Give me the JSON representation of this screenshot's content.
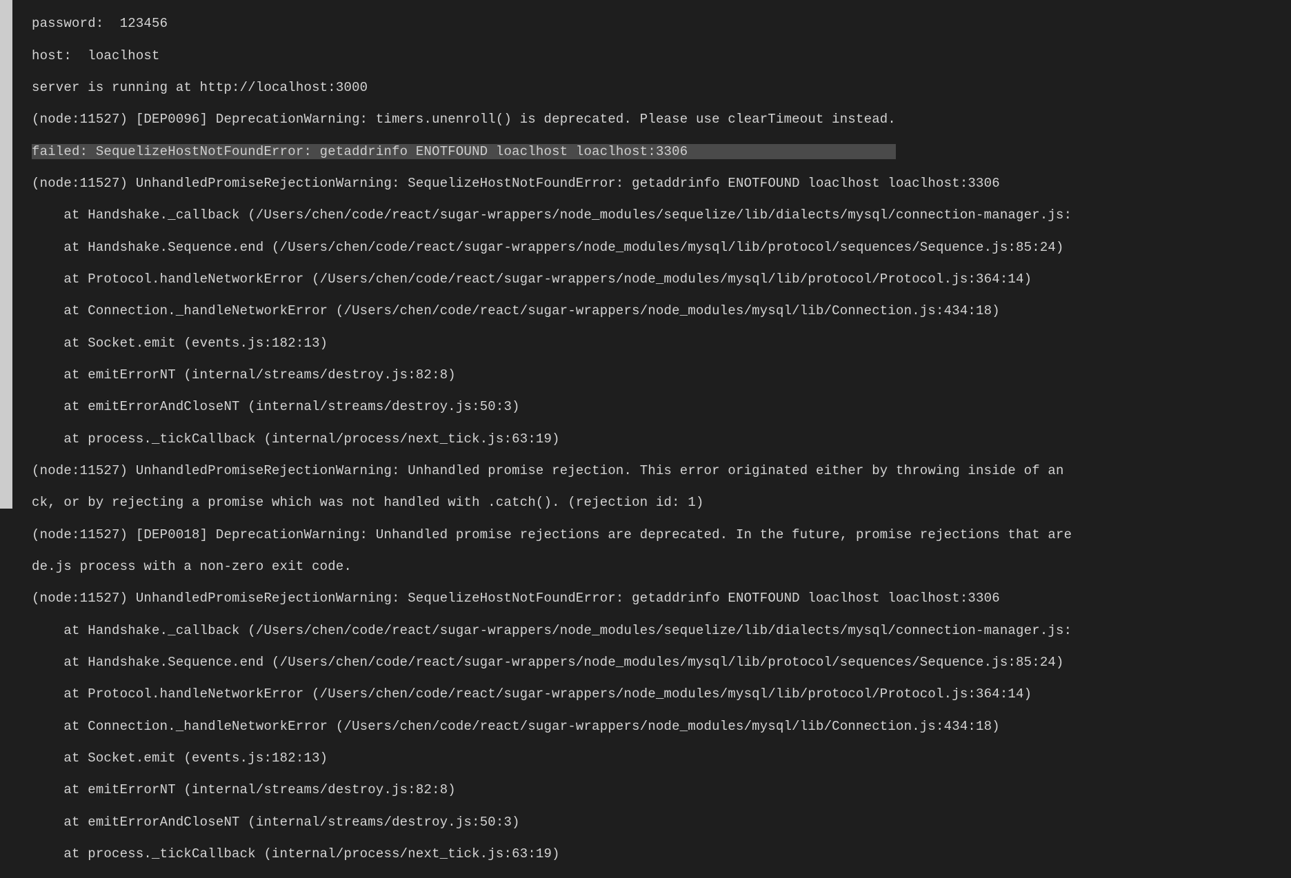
{
  "lines": [
    {
      "text": "password:  123456",
      "cls": "line",
      "selected": false
    },
    {
      "text": "host:  loaclhost",
      "cls": "line",
      "selected": false
    },
    {
      "text": "server is running at http://localhost:3000",
      "cls": "line",
      "selected": false
    },
    {
      "text": "(node:11527) [DEP0096] DeprecationWarning: timers.unenroll() is deprecated. Please use clearTimeout instead.",
      "cls": "line",
      "selected": false
    },
    {
      "text": "failed: SequelizeHostNotFoundError: getaddrinfo ENOTFOUND loaclhost loaclhost:3306                          ",
      "cls": "line",
      "selected": true
    },
    {
      "text": "(node:11527) UnhandledPromiseRejectionWarning: SequelizeHostNotFoundError: getaddrinfo ENOTFOUND loaclhost loaclhost:3306",
      "cls": "line",
      "selected": false
    },
    {
      "text": "    at Handshake._callback (/Users/chen/code/react/sugar-wrappers/node_modules/sequelize/lib/dialects/mysql/connection-manager.js:",
      "cls": "line",
      "selected": false
    },
    {
      "text": "    at Handshake.Sequence.end (/Users/chen/code/react/sugar-wrappers/node_modules/mysql/lib/protocol/sequences/Sequence.js:85:24)",
      "cls": "line",
      "selected": false
    },
    {
      "text": "    at Protocol.handleNetworkError (/Users/chen/code/react/sugar-wrappers/node_modules/mysql/lib/protocol/Protocol.js:364:14)",
      "cls": "line",
      "selected": false
    },
    {
      "text": "    at Connection._handleNetworkError (/Users/chen/code/react/sugar-wrappers/node_modules/mysql/lib/Connection.js:434:18)",
      "cls": "line",
      "selected": false
    },
    {
      "text": "    at Socket.emit (events.js:182:13)",
      "cls": "line",
      "selected": false
    },
    {
      "text": "    at emitErrorNT (internal/streams/destroy.js:82:8)",
      "cls": "line",
      "selected": false
    },
    {
      "text": "    at emitErrorAndCloseNT (internal/streams/destroy.js:50:3)",
      "cls": "line",
      "selected": false
    },
    {
      "text": "    at process._tickCallback (internal/process/next_tick.js:63:19)",
      "cls": "line",
      "selected": false
    },
    {
      "text": "(node:11527) UnhandledPromiseRejectionWarning: Unhandled promise rejection. This error originated either by throwing inside of an",
      "cls": "line",
      "selected": false
    },
    {
      "text": "ck, or by rejecting a promise which was not handled with .catch(). (rejection id: 1)",
      "cls": "line",
      "selected": false
    },
    {
      "text": "(node:11527) [DEP0018] DeprecationWarning: Unhandled promise rejections are deprecated. In the future, promise rejections that are",
      "cls": "line",
      "selected": false
    },
    {
      "text": "de.js process with a non-zero exit code.",
      "cls": "line",
      "selected": false
    },
    {
      "text": "(node:11527) UnhandledPromiseRejectionWarning: SequelizeHostNotFoundError: getaddrinfo ENOTFOUND loaclhost loaclhost:3306",
      "cls": "line",
      "selected": false
    },
    {
      "text": "    at Handshake._callback (/Users/chen/code/react/sugar-wrappers/node_modules/sequelize/lib/dialects/mysql/connection-manager.js:",
      "cls": "line",
      "selected": false
    },
    {
      "text": "    at Handshake.Sequence.end (/Users/chen/code/react/sugar-wrappers/node_modules/mysql/lib/protocol/sequences/Sequence.js:85:24)",
      "cls": "line",
      "selected": false
    },
    {
      "text": "    at Protocol.handleNetworkError (/Users/chen/code/react/sugar-wrappers/node_modules/mysql/lib/protocol/Protocol.js:364:14)",
      "cls": "line",
      "selected": false
    },
    {
      "text": "    at Connection._handleNetworkError (/Users/chen/code/react/sugar-wrappers/node_modules/mysql/lib/Connection.js:434:18)",
      "cls": "line",
      "selected": false
    },
    {
      "text": "    at Socket.emit (events.js:182:13)",
      "cls": "line",
      "selected": false
    },
    {
      "text": "    at emitErrorNT (internal/streams/destroy.js:82:8)",
      "cls": "line",
      "selected": false
    },
    {
      "text": "    at emitErrorAndCloseNT (internal/streams/destroy.js:50:3)",
      "cls": "line",
      "selected": false
    },
    {
      "text": "    at process._tickCallback (internal/process/next_tick.js:63:19)",
      "cls": "line",
      "selected": false
    }
  ]
}
